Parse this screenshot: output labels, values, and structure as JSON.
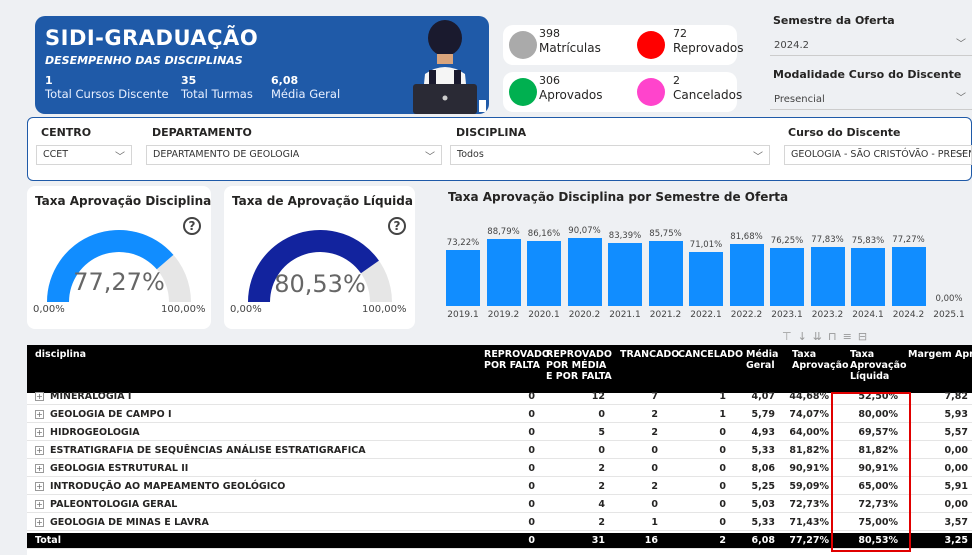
{
  "header": {
    "title": "SIDI-GRADUAÇÃO",
    "subtitle": "DESEMPENHO DAS DISCIPLINAS",
    "kpis": [
      {
        "value": "1",
        "label": "Total Cursos Discente"
      },
      {
        "value": "35",
        "label": "Total Turmas"
      },
      {
        "value": "6,08",
        "label": "Média Geral"
      }
    ]
  },
  "stats": [
    {
      "value": "398",
      "label": "Matrículas",
      "color": "#aaaaaa"
    },
    {
      "value": "72",
      "label": "Reprovados",
      "color": "#ff0000"
    },
    {
      "value": "306",
      "label": "Aprovados",
      "color": "#00b050"
    },
    {
      "value": "2",
      "label": "Cancelados",
      "color": "#ff44cc"
    }
  ],
  "slicers": {
    "semestre_title": "Semestre da Oferta",
    "semestre_value": "2024.2",
    "modalidade_title": "Modalidade Curso do Discente",
    "modalidade_value": "Presencial"
  },
  "filters": {
    "centro_label": "CENTRO",
    "centro_value": "CCET",
    "departamento_label": "DEPARTAMENTO",
    "departamento_value": "DEPARTAMENTO DE GEOLOGIA",
    "disciplina_label": "DISCIPLINA",
    "disciplina_value": "Todos",
    "curso_label": "Curso do Discente",
    "curso_value": "GEOLOGIA - SÃO CRISTÓVÃO - PRESENCI..."
  },
  "gauge1": {
    "title": "Taxa Aprovação Disciplina",
    "value": "77,27%",
    "fraction": 0.7727,
    "min": "0,00%",
    "max": "100,00%",
    "color": "#118dff"
  },
  "gauge2": {
    "title": "Taxa de Aprovação Líquida",
    "value": "80,53%",
    "fraction": 0.8053,
    "min": "0,00%",
    "max": "100,00%",
    "color": "#12239e"
  },
  "chart_data": {
    "type": "bar",
    "title": "Taxa Aprovação Disciplina por Semestre de Oferta",
    "categories": [
      "2019.1",
      "2019.2",
      "2020.1",
      "2020.2",
      "2021.1",
      "2021.2",
      "2022.1",
      "2022.2",
      "2023.1",
      "2023.2",
      "2024.1",
      "2024.2",
      "2025.1"
    ],
    "values": [
      73.22,
      88.79,
      86.16,
      90.07,
      83.39,
      85.75,
      71.01,
      81.68,
      76.25,
      77.83,
      75.83,
      77.27,
      0.0
    ],
    "labels": [
      "73,22%",
      "88,79%",
      "86,16%",
      "90,07%",
      "83,39%",
      "85,75%",
      "71,01%",
      "81,68%",
      "76,25%",
      "77,83%",
      "75,83%",
      "77,27%",
      "0,00%"
    ],
    "ylim": [
      0,
      100
    ],
    "color": "#118dff"
  },
  "table": {
    "headers": [
      "disciplina",
      "REPROVADO POR FALTA",
      "REPROVADO POR MÉDIA E POR FALTA",
      "TRANCADO",
      "CANCELADO",
      "Média Geral",
      "Taxa Aprovação",
      "Taxa Aprovação Líquida",
      "Margem Aprovação Líq"
    ],
    "rows": [
      [
        "MINERALOGIA I",
        "0",
        "12",
        "7",
        "1",
        "4,07",
        "44,68%",
        "52,50%",
        "7,82"
      ],
      [
        "GEOLOGIA DE CAMPO I",
        "0",
        "0",
        "2",
        "1",
        "5,79",
        "74,07%",
        "80,00%",
        "5,93"
      ],
      [
        "HIDROGEOLOGIA",
        "0",
        "5",
        "2",
        "0",
        "4,93",
        "64,00%",
        "69,57%",
        "5,57"
      ],
      [
        "ESTRATIGRAFIA DE SEQUÊNCIAS ANÁLISE ESTRATIGRAFICA",
        "0",
        "0",
        "0",
        "0",
        "5,33",
        "81,82%",
        "81,82%",
        "0,00"
      ],
      [
        "GEOLOGIA ESTRUTURAL II",
        "0",
        "2",
        "0",
        "0",
        "8,06",
        "90,91%",
        "90,91%",
        "0,00"
      ],
      [
        "INTRODUÇÃO AO MAPEAMENTO GEOLÓGICO",
        "0",
        "2",
        "2",
        "0",
        "5,25",
        "59,09%",
        "65,00%",
        "5,91"
      ],
      [
        "PALEONTOLOGIA GERAL",
        "0",
        "4",
        "0",
        "0",
        "5,03",
        "72,73%",
        "72,73%",
        "0,00"
      ],
      [
        "GEOLOGIA DE MINAS E LAVRA",
        "0",
        "2",
        "1",
        "0",
        "5,33",
        "71,43%",
        "75,00%",
        "3,57"
      ]
    ],
    "total": [
      "Total",
      "0",
      "31",
      "16",
      "2",
      "6,08",
      "77,27%",
      "80,53%",
      "3,25"
    ]
  }
}
